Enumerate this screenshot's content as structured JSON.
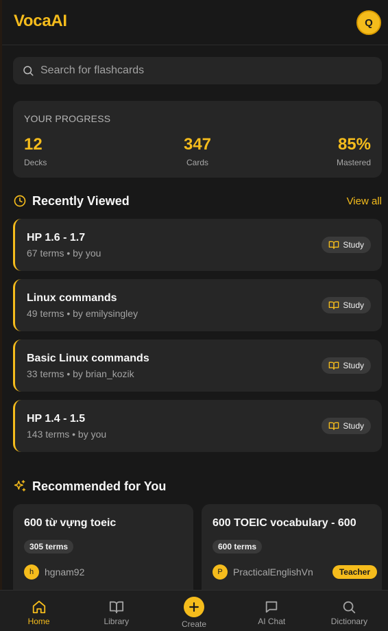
{
  "app": {
    "logo": "VocaAI",
    "user_initial": "Q"
  },
  "colors": {
    "accent": "#f5bc1c",
    "background": "#181818",
    "card": "#262626",
    "muted_text": "#a3a3a3"
  },
  "search": {
    "placeholder": "Search for flashcards",
    "value": ""
  },
  "progress": {
    "title": "YOUR PROGRESS",
    "stats": [
      {
        "value": "12",
        "label": "Decks"
      },
      {
        "value": "347",
        "label": "Cards"
      },
      {
        "value": "85%",
        "label": "Mastered"
      }
    ]
  },
  "recent": {
    "title": "Recently Viewed",
    "view_all": "View all",
    "icon": "clock-icon",
    "items": [
      {
        "title": "HP 1.6 - 1.7",
        "meta": "67 terms • by you",
        "action": "Study"
      },
      {
        "title": "Linux commands",
        "meta": "49 terms • by emilysingley",
        "action": "Study"
      },
      {
        "title": "Basic Linux commands",
        "meta": "33 terms • by brian_kozik",
        "action": "Study"
      },
      {
        "title": "HP 1.4 - 1.5",
        "meta": "143 terms • by you",
        "action": "Study"
      }
    ]
  },
  "recommended": {
    "title": "Recommended for You",
    "icon": "sparkles-icon",
    "items": [
      {
        "title": "600 từ vựng toeic",
        "terms": "305 terms",
        "author_initial": "h",
        "author": "hgnam92",
        "badge": ""
      },
      {
        "title": "600 TOEIC vocabulary - 600",
        "terms": "600 terms",
        "author_initial": "P",
        "author": "PracticalEnglishVn",
        "badge": "Teacher"
      }
    ]
  },
  "nav": {
    "active": "Home",
    "items": [
      {
        "label": "Home",
        "icon": "home-icon"
      },
      {
        "label": "Library",
        "icon": "book-icon"
      },
      {
        "label": "Create",
        "icon": "plus-icon"
      },
      {
        "label": "AI Chat",
        "icon": "chat-icon"
      },
      {
        "label": "Dictionary",
        "icon": "search-icon"
      }
    ]
  }
}
